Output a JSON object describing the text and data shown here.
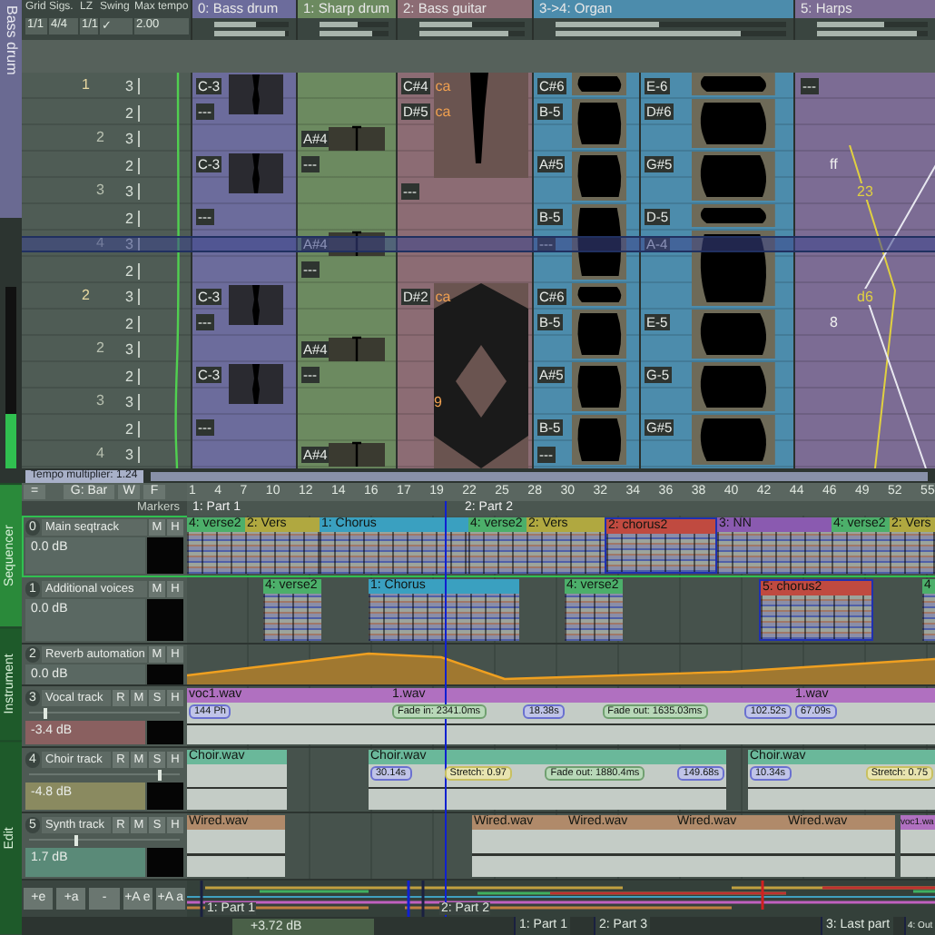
{
  "tracker": {
    "side_tab": "Bass drum",
    "meter": {
      "level": 0.3
    },
    "settings": [
      {
        "label": "Grid",
        "value": "1/1"
      },
      {
        "label": "Sigs.",
        "value": "4/4"
      },
      {
        "label": "LZ",
        "value": "1/1"
      },
      {
        "label": "Swing",
        "value": "✓"
      },
      {
        "label": "Max tempo",
        "value": "2.00"
      }
    ],
    "tracks": [
      {
        "label": "0:  Bass drum",
        "color": "#6c6c9c",
        "sliders": [
          {
            "level": 0.55
          },
          {
            "level": 0.95
          }
        ]
      },
      {
        "label": "1:  Sharp drum",
        "color": "#6c8a60",
        "sliders": [
          {
            "level": 0.55
          },
          {
            "level": 0.75
          }
        ]
      },
      {
        "label": "2:  Bass guitar",
        "color": "#8c6c74",
        "sliders": [
          {
            "level": 0.5
          },
          {
            "level": 0.85
          }
        ]
      },
      {
        "label": "3->4:  Organ",
        "color": "#4c8cac",
        "sliders": [
          {
            "level": 0.45
          },
          {
            "level": 0.8
          }
        ]
      },
      {
        "label": "5:  Harps",
        "color": "#7c6c94",
        "sliders": [
          {
            "level": 0.6
          },
          {
            "level": 0.9
          }
        ]
      }
    ],
    "rows": [
      {
        "bar": "1",
        "tick": "3",
        "bass_drum": "C-3",
        "bass_guitar": "C#4",
        "bass_guitar_fx": "ca",
        "organ_a": "C#6",
        "organ_b": "E-6",
        "harps_a": "---"
      },
      {
        "tick": "2",
        "bass_drum": "---",
        "bass_guitar": "D#5",
        "bass_guitar_fx": "ca",
        "organ_a": "B-5",
        "organ_b": "D#6"
      },
      {
        "beat": "2",
        "tick": "3",
        "sharp_drum": "A#4"
      },
      {
        "tick": "2",
        "bass_drum": "C-3",
        "sharp_drum": "---",
        "organ_a": "A#5",
        "organ_b": "G#5",
        "harps_a": "ff"
      },
      {
        "beat": "3",
        "tick": "3",
        "bass_guitar": "---",
        "harps_b": "23"
      },
      {
        "tick": "2",
        "bass_drum": "---",
        "organ_a": "B-5",
        "organ_b": "D-5"
      },
      {
        "beat": "4",
        "tick": "3",
        "sharp_drum": "A#4",
        "organ_a": "---",
        "organ_b": "A-4"
      },
      {
        "tick": "2",
        "sharp_drum": "---"
      },
      {
        "bar": "2",
        "tick": "3",
        "bass_drum": "C-3",
        "bass_guitar": "D#2",
        "bass_guitar_fx": "ca",
        "organ_a": "C#6",
        "harps_b": "d6"
      },
      {
        "tick": "2",
        "bass_drum": "---",
        "organ_a": "B-5",
        "organ_b": "E-5",
        "harps_a": "8"
      },
      {
        "beat": "2",
        "tick": "3",
        "sharp_drum": "A#4"
      },
      {
        "tick": "2",
        "bass_drum": "C-3",
        "sharp_drum": "---",
        "organ_a": "A#5",
        "organ_b": "G-5"
      },
      {
        "beat": "3",
        "tick": "3",
        "bass_guitar_fx": "9"
      },
      {
        "tick": "2",
        "bass_drum": "---",
        "organ_a": "B-5",
        "organ_b": "G#5"
      },
      {
        "beat": "4",
        "tick": "3",
        "sharp_drum": "A#4",
        "organ_a": "---"
      }
    ],
    "tempo_multiplier": "Tempo multiplier: 1.24"
  },
  "sequencer": {
    "side_tabs": [
      {
        "label": "Sequencer",
        "selected": true
      },
      {
        "label": "Instrument",
        "selected": false
      },
      {
        "label": "Edit",
        "selected": false
      }
    ],
    "toolbar": [
      "=",
      "G: Bar",
      "W",
      "F"
    ],
    "ruler": [
      "1",
      "4",
      "7",
      "10",
      "12",
      "14",
      "16",
      "17",
      "19",
      "22",
      "25",
      "28",
      "30",
      "32",
      "34",
      "36",
      "38",
      "40",
      "42",
      "44",
      "46",
      "49",
      "52",
      "55"
    ],
    "markers_label": "Markers",
    "markers": [
      "1: Part 1",
      "2: Part 2"
    ],
    "tracks": [
      {
        "kind": "seq",
        "number": "0",
        "name": "Main seqtrack",
        "buttons": [
          "M",
          "H"
        ],
        "volume": "0.0 dB",
        "color": "#5a6862",
        "selected": true,
        "clips": [
          {
            "title": "4: verse2",
            "color": "#4caf6a",
            "selected": false
          },
          {
            "title": "2: Vers",
            "color": "#b0a840",
            "selected": false
          },
          {
            "title": "1: Chorus",
            "color": "#3aa0c0",
            "selected": false
          },
          {
            "title": "4: verse2",
            "color": "#4caf6a",
            "selected": false
          },
          {
            "title": "2: Vers",
            "color": "#b0a840",
            "selected": false
          },
          {
            "title": "2: chorus2",
            "color": "#c04a40",
            "selected": true
          },
          {
            "title": "3: NN",
            "color": "#8a5ab0",
            "selected": false
          },
          {
            "title": "4: verse2",
            "color": "#4caf6a",
            "selected": false
          },
          {
            "title": "2: Vers",
            "color": "#b0a840",
            "selected": false
          }
        ]
      },
      {
        "kind": "seq",
        "number": "1",
        "name": "Additional voices",
        "buttons": [
          "M",
          "H"
        ],
        "volume": "0.0 dB",
        "color": "#5a6862",
        "selected": false,
        "clips": [
          {
            "title": "4: verse2",
            "color": "#4caf6a",
            "selected": false
          },
          {
            "title": "1: Chorus",
            "color": "#3aa0c0",
            "selected": false
          },
          {
            "title": "4: verse2",
            "color": "#4caf6a",
            "selected": false
          },
          {
            "title": "5: chorus2",
            "color": "#c04a40",
            "selected": true
          },
          {
            "title": "4",
            "color": "#4caf6a",
            "selected": false
          }
        ]
      },
      {
        "kind": "automation",
        "number": "2",
        "name": "Reverb automation",
        "buttons": [
          "M",
          "H"
        ],
        "volume": "0.0 dB",
        "color": "#5a6862",
        "selected": false
      },
      {
        "kind": "audio",
        "number": "3",
        "name": "Vocal track",
        "buttons": [
          "R",
          "M",
          "S",
          "H"
        ],
        "slider": {
          "level": 0.1
        },
        "volume": "-3.4 dB",
        "color": "#8a6060",
        "selected": false,
        "clips": [
          {
            "title": "voc1.wav",
            "color": "#b070c0",
            "labels": [
              {
                "kind": "length",
                "text": "144 Ph"
              }
            ]
          },
          {
            "title": "1.wav",
            "color": "#b070c0",
            "labels": [
              {
                "kind": "fade",
                "text": "Fade in: 2341.0ms"
              },
              {
                "kind": "length",
                "text": "18.38s"
              },
              {
                "kind": "fade",
                "text": "Fade out: 1635.03ms"
              },
              {
                "kind": "length",
                "text": "102.52s"
              }
            ]
          },
          {
            "title": "1.wav",
            "color": "#b070c0",
            "labels": [
              {
                "kind": "length",
                "text": "67.09s"
              }
            ]
          }
        ]
      },
      {
        "kind": "audio",
        "number": "4",
        "name": "Choir track",
        "buttons": [
          "R",
          "M",
          "S",
          "H"
        ],
        "slider": {
          "level": 0.85
        },
        "volume": "-4.8 dB",
        "color": "#8a8a60",
        "selected": false,
        "clips": [
          {
            "title": "Choir.wav",
            "color": "#6ab89a"
          },
          {
            "title": "Choir.wav",
            "color": "#6ab89a",
            "labels": [
              {
                "kind": "length",
                "text": "30.14s"
              },
              {
                "kind": "stretch",
                "text": "Stretch: 0.97"
              },
              {
                "kind": "fade",
                "text": "Fade out: 1880.4ms"
              },
              {
                "kind": "length",
                "text": "149.68s"
              }
            ]
          },
          {
            "title": "Choir.wav",
            "color": "#6ab89a",
            "labels": [
              {
                "kind": "length",
                "text": "10.34s"
              },
              {
                "kind": "stretch",
                "text": "Stretch: 0.75"
              }
            ]
          }
        ]
      },
      {
        "kind": "audio",
        "number": "5",
        "name": "Synth track",
        "buttons": [
          "R",
          "M",
          "S",
          "H"
        ],
        "slider": {
          "level": 0.3
        },
        "volume": "1.7 dB",
        "color": "#5a8a78",
        "selected": false,
        "clips": [
          {
            "title": "Wired.wav",
            "color": "#b08a6a"
          },
          {
            "title": "Wired.wav",
            "color": "#b08a6a"
          },
          {
            "title": "Wired.wav",
            "color": "#b08a6a"
          },
          {
            "title": "Wired.wav",
            "color": "#b08a6a"
          },
          {
            "title": "Wired.wav",
            "color": "#b08a6a"
          },
          {
            "title": "voc1.wa",
            "color": "#b070c0"
          }
        ]
      }
    ],
    "bottom_buttons": [
      "+e",
      "+a",
      "-",
      "+A e",
      "+A a"
    ],
    "navigator_parts": [
      "1: Part 1",
      "2: Part 2"
    ],
    "status": "+3.72 dB",
    "playlist": [
      "1: Part 1",
      "2: Part 3",
      "3: Last part",
      "4: Out"
    ]
  }
}
